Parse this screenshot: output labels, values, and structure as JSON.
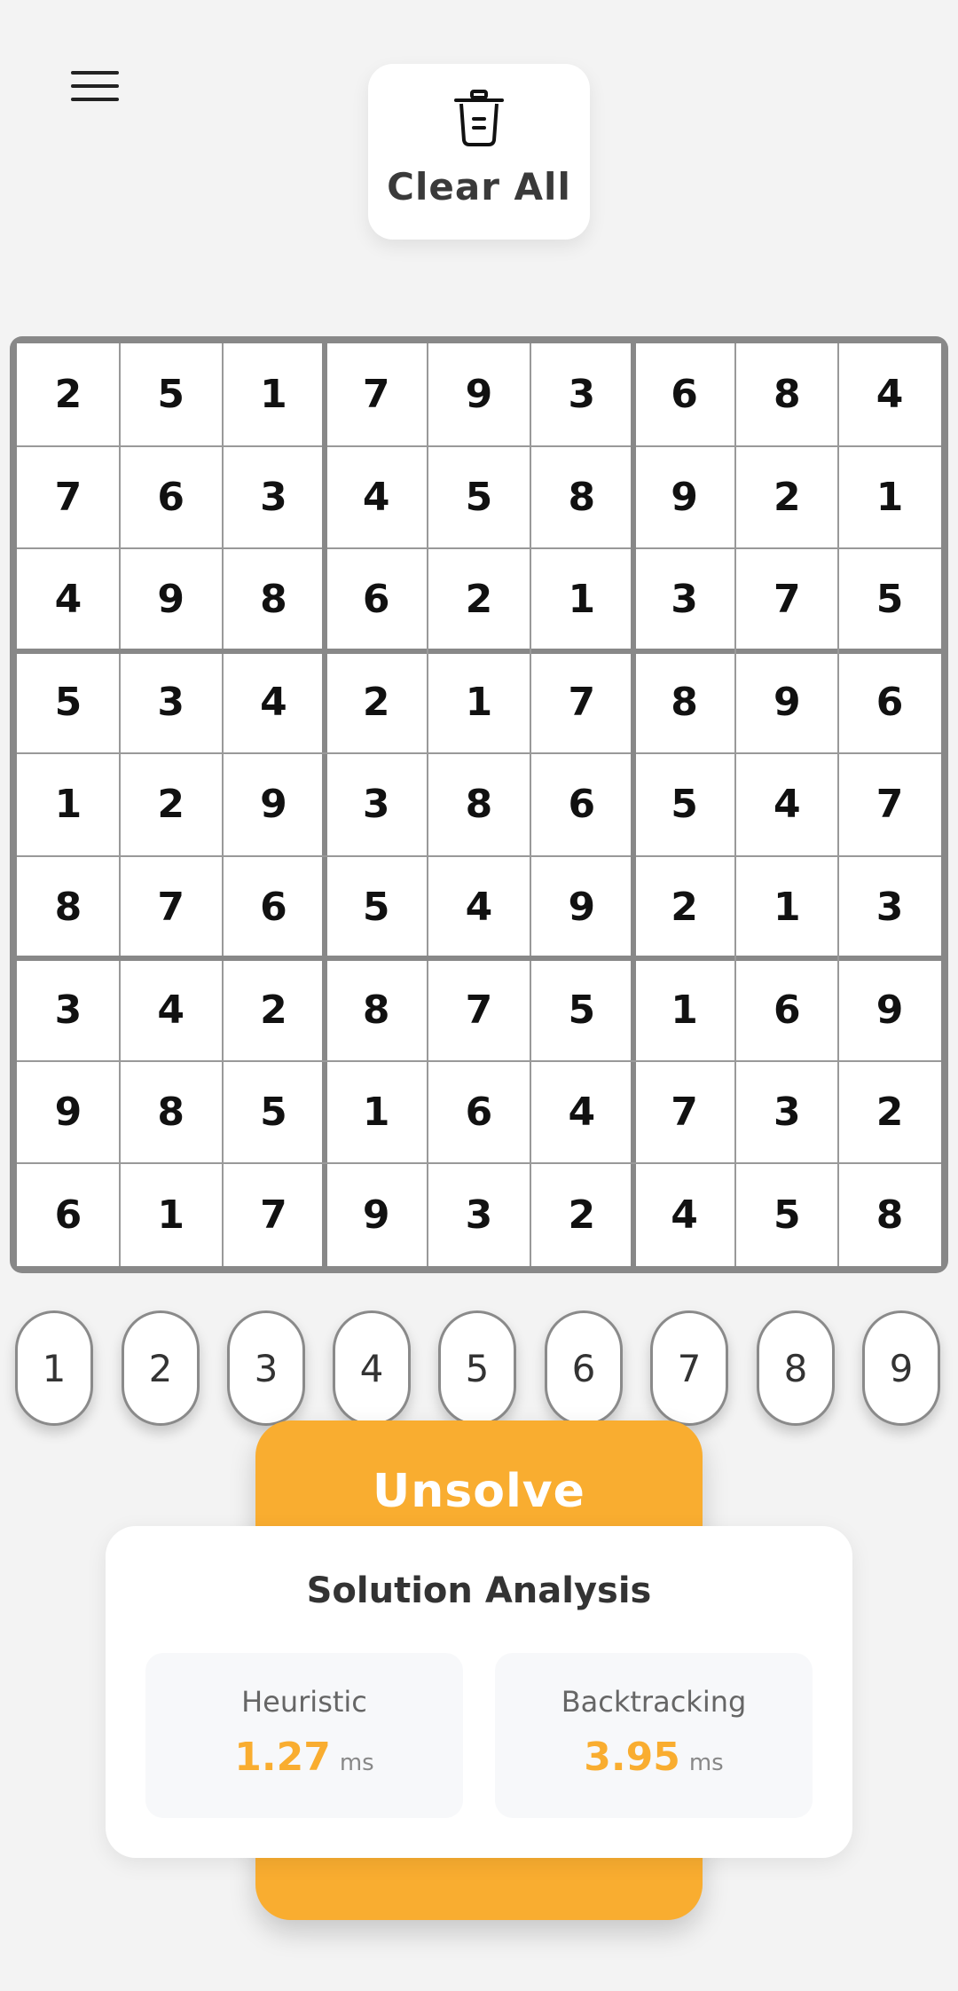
{
  "header": {
    "menu_icon": "hamburger-menu-icon",
    "clear_button": {
      "label": "Clear All",
      "icon": "trash-icon"
    }
  },
  "board": {
    "rows": [
      [
        2,
        5,
        1,
        7,
        9,
        3,
        6,
        8,
        4
      ],
      [
        7,
        6,
        3,
        4,
        5,
        8,
        9,
        2,
        1
      ],
      [
        4,
        9,
        8,
        6,
        2,
        1,
        3,
        7,
        5
      ],
      [
        5,
        3,
        4,
        2,
        1,
        7,
        8,
        9,
        6
      ],
      [
        1,
        2,
        9,
        3,
        8,
        6,
        5,
        4,
        7
      ],
      [
        8,
        7,
        6,
        5,
        4,
        9,
        2,
        1,
        3
      ],
      [
        3,
        4,
        2,
        8,
        7,
        5,
        1,
        6,
        9
      ],
      [
        9,
        8,
        5,
        1,
        6,
        4,
        7,
        3,
        2
      ],
      [
        6,
        1,
        7,
        9,
        3,
        2,
        4,
        5,
        8
      ]
    ]
  },
  "number_pad": [
    "1",
    "2",
    "3",
    "4",
    "5",
    "6",
    "7",
    "8",
    "9"
  ],
  "action_button": {
    "label": "Unsolve",
    "color": "#f9ad30"
  },
  "analysis": {
    "title": "Solution Analysis",
    "heuristic": {
      "label": "Heuristic",
      "value": "1.27",
      "unit": "ms"
    },
    "backtracking": {
      "label": "Backtracking",
      "value": "3.95",
      "unit": "ms"
    }
  },
  "colors": {
    "accent": "#f9ad30",
    "background": "#f3f3f3",
    "grid_border": "#888888"
  }
}
